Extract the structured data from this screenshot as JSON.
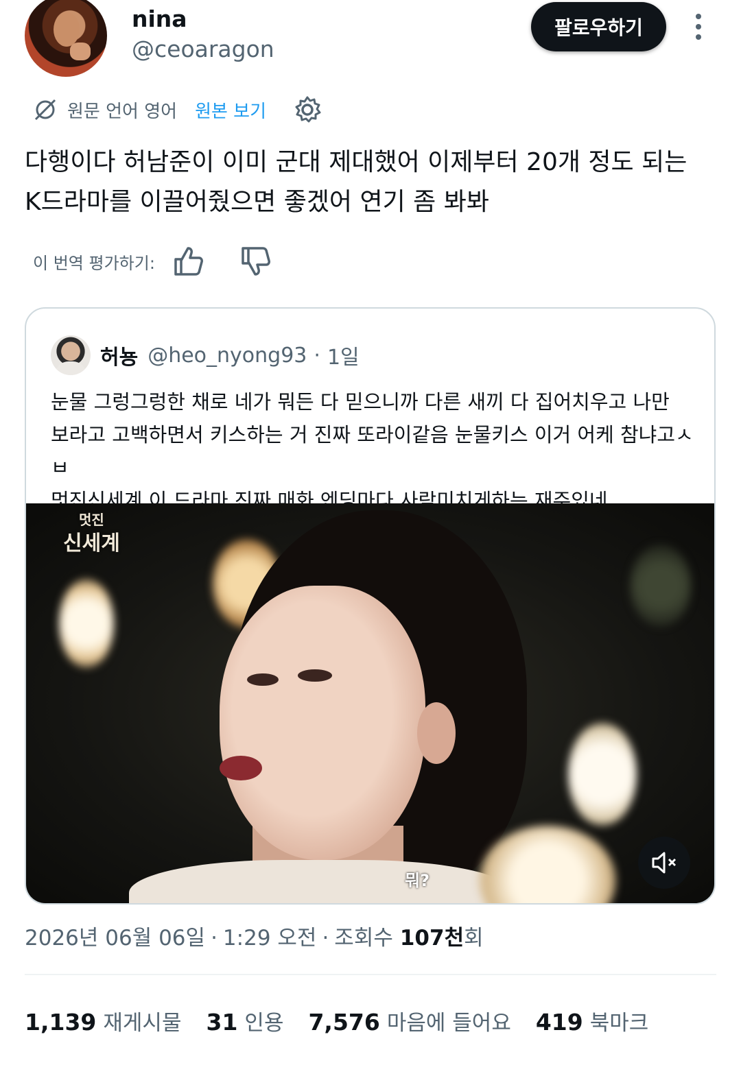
{
  "author": {
    "name": "nina",
    "handle": "@ceoaragon",
    "follow_label": "팔로우하기"
  },
  "translation": {
    "source_language": "원문 언어 영어",
    "show_original": "원본 보기",
    "rate_label": "이 번역 평가하기:"
  },
  "tweet": {
    "text": "다행이다 허남준이 이미 군대 제대했어 이제부터 20개 정도 되는\nK드라마를 이끌어줬으면 좋겠어 연기 좀 봐봐"
  },
  "quote": {
    "name": "허뇽",
    "handle": "@heo_nyong93",
    "dot": "·",
    "time": "1일",
    "text": "눈물 그렁그렁한 채로 네가 뭐든 다 믿으니까 다른 새끼 다 집어치우고 나만\n보라고 고백하면서 키스하는 거 진짜 또라이같음 눈물키스 이거 어케 참냐고ㅅㅂ\n멋진신세계 이 드라마 진짜 매화 엔딩마다 사람미치게하는 재주있네",
    "media": {
      "logo_line1": "멋진",
      "logo_line2": "신세계",
      "subtitle": "뭐?"
    }
  },
  "meta": {
    "date": "2026년 06월 06일",
    "time": "1:29 오전",
    "views_label": "조회수",
    "views_num": "107천",
    "views_suffix": "회"
  },
  "stats": {
    "reposts_num": "1,139",
    "reposts_label": "재게시물",
    "quotes_num": "31",
    "quotes_label": "인용",
    "likes_num": "7,576",
    "likes_label": "마음에 들어요",
    "bookmarks_num": "419",
    "bookmarks_label": "북마크"
  },
  "colors": {
    "accent": "#1d9bf0",
    "text": "#0f1419",
    "secondary": "#536471",
    "border": "#cfd9de"
  },
  "icons": [
    "globe-slash-icon",
    "gear-icon",
    "thumbs-up-icon",
    "thumbs-down-icon",
    "more-vertical-icon",
    "mute-icon"
  ]
}
